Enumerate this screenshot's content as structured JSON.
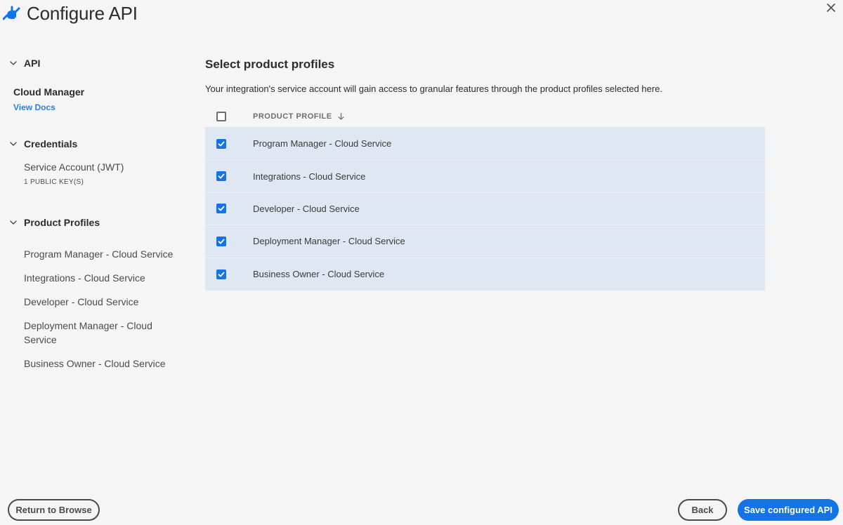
{
  "header": {
    "title": "Configure API"
  },
  "sidebar": {
    "api": {
      "section_label": "API",
      "name": "Cloud Manager",
      "docs_link": "View Docs"
    },
    "credentials": {
      "section_label": "Credentials",
      "name": "Service Account (JWT)",
      "sub": "1 PUBLIC KEY(S)"
    },
    "product_profiles": {
      "section_label": "Product Profiles",
      "items": [
        "Program Manager - Cloud Service",
        "Integrations - Cloud Service",
        "Developer - Cloud Service",
        "Deployment Manager - Cloud Service",
        "Business Owner - Cloud Service"
      ]
    }
  },
  "main": {
    "title": "Select product profiles",
    "description": "Your integration's service account will gain access to granular features through the product profiles selected here.",
    "table": {
      "column_header": "PRODUCT PROFILE",
      "select_all_checked": false,
      "rows": [
        {
          "label": "Program Manager - Cloud Service",
          "checked": true
        },
        {
          "label": "Integrations - Cloud Service",
          "checked": true
        },
        {
          "label": "Developer - Cloud Service",
          "checked": true
        },
        {
          "label": "Deployment Manager - Cloud Service",
          "checked": true
        },
        {
          "label": "Business Owner - Cloud Service",
          "checked": true
        }
      ]
    }
  },
  "footer": {
    "return_label": "Return to Browse",
    "back_label": "Back",
    "save_label": "Save configured API"
  },
  "colors": {
    "accent": "#1473e6",
    "link": "#2680eb",
    "row_selected_bg": "#dfe8f2"
  },
  "icons": {
    "header": "plug-icon",
    "close": "close-icon",
    "section_toggle": "chevron-down-icon",
    "sort": "arrow-down-icon",
    "checkbox": "checkmark-icon"
  }
}
